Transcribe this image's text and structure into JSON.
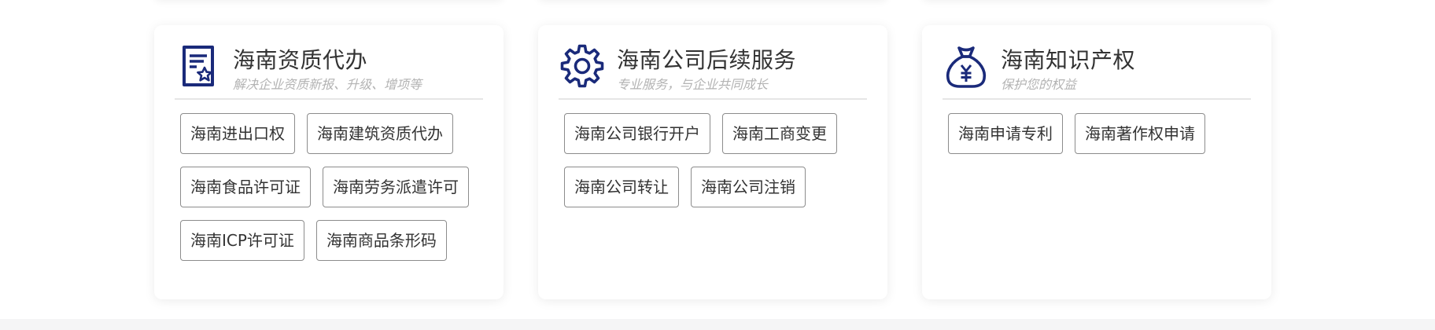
{
  "accent_color": "#1a2a7a",
  "cards": [
    {
      "icon": "certificate-icon",
      "title": "海南资质代办",
      "subtitle": "解决企业资质新报、升级、增项等",
      "tags": [
        "海南进出口权",
        "海南建筑资质代办",
        "海南食品许可证",
        "海南劳务派遣许可",
        "海南ICP许可证",
        "海南商品条形码"
      ]
    },
    {
      "icon": "gear-icon",
      "title": "海南公司后续服务",
      "subtitle": "专业服务，与企业共同成长",
      "tags": [
        "海南公司银行开户",
        "海南工商变更",
        "海南公司转让",
        "海南公司注销"
      ]
    },
    {
      "icon": "money-bag-icon",
      "title": "海南知识产权",
      "subtitle": "保护您的权益",
      "tags": [
        "海南申请专利",
        "海南著作权申请"
      ]
    }
  ]
}
